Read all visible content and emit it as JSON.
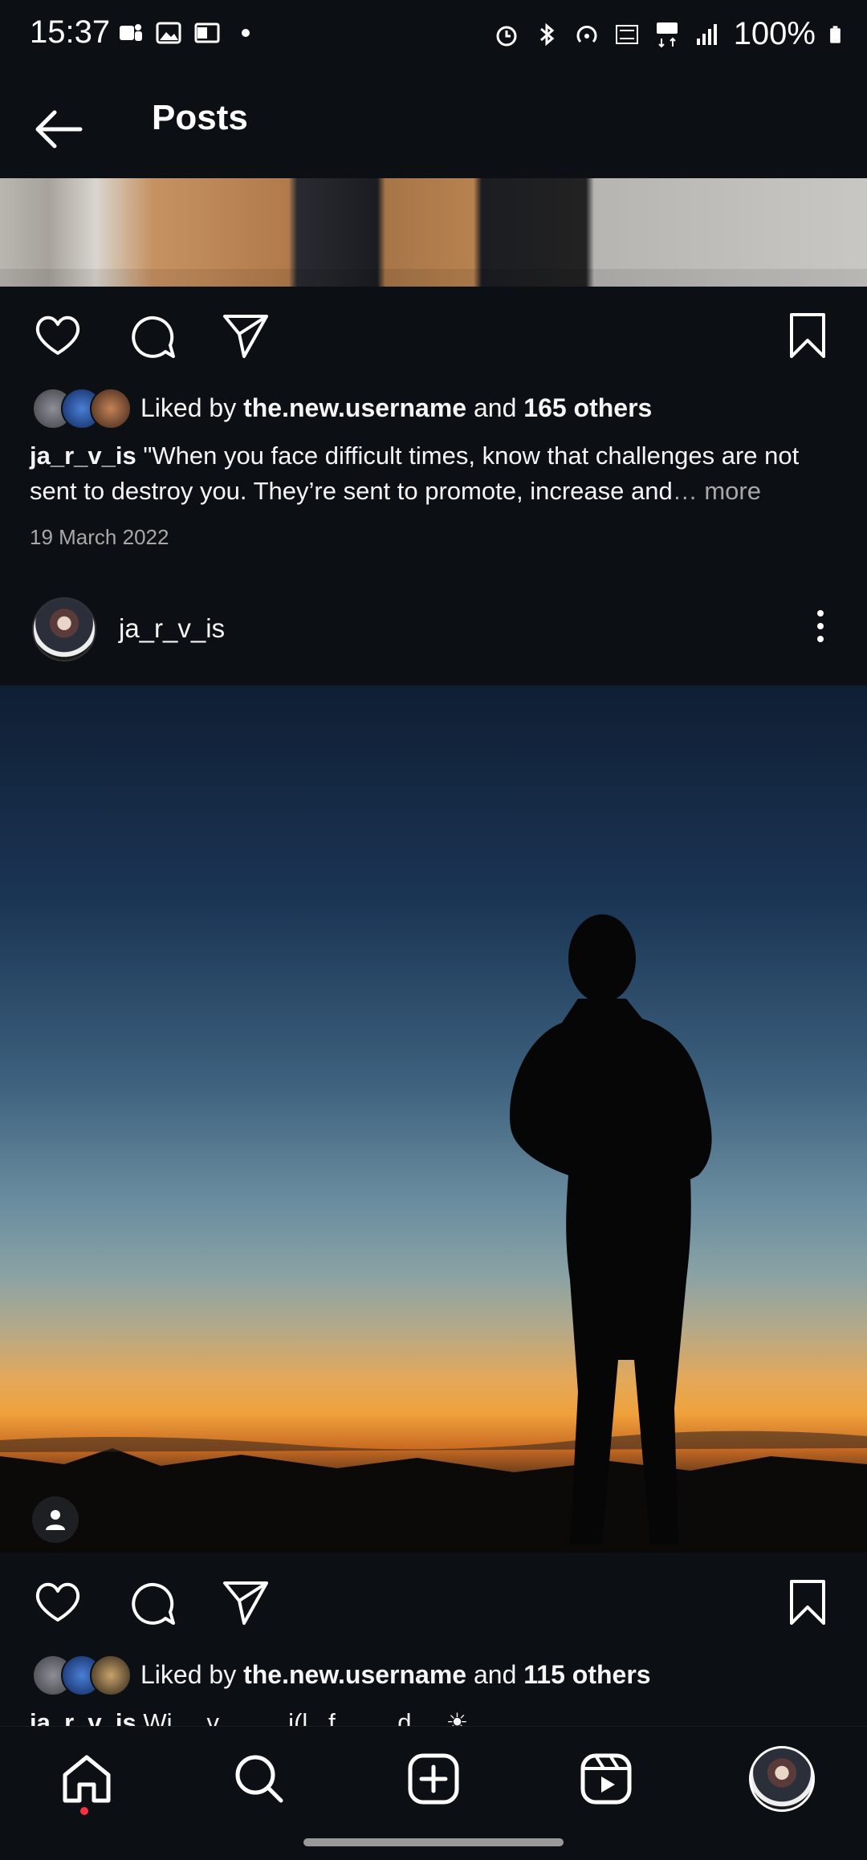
{
  "status_bar": {
    "time": "15:37",
    "battery": "100%"
  },
  "header": {
    "title": "Posts"
  },
  "post1": {
    "likes_prefix": "Liked by ",
    "likes_user": "the.new.username",
    "likes_and": " and ",
    "likes_others": "165 others",
    "caption_user": "ja_r_v_is",
    "caption_text": " \"When you face difficult times, know that challenges are not sent to destroy you. They’re sent to promote, increase and",
    "caption_more": "… more",
    "date": "19 March 2022"
  },
  "post2": {
    "username": "ja_r_v_is",
    "likes_prefix": "Liked by ",
    "likes_user": "the.new.username",
    "likes_and": " and ",
    "likes_others": "115 others",
    "caption_user": "ja_r_v_is",
    "caption_text": " Wi . . v . . . . .i(l . f . . . . d . ."
  },
  "colors": {
    "background": "#0c1014",
    "text": "#f5f5f5",
    "muted": "#a8a8a8",
    "notification_dot": "#ff3040"
  },
  "icons": {
    "back": "arrow-left-icon",
    "like": "heart-icon",
    "comment": "comment-icon",
    "share": "send-icon",
    "save": "bookmark-icon",
    "more": "kebab-icon",
    "user_tag": "person-icon",
    "nav": [
      "home-icon",
      "search-icon",
      "create-icon",
      "reels-icon",
      "profile-avatar"
    ]
  }
}
